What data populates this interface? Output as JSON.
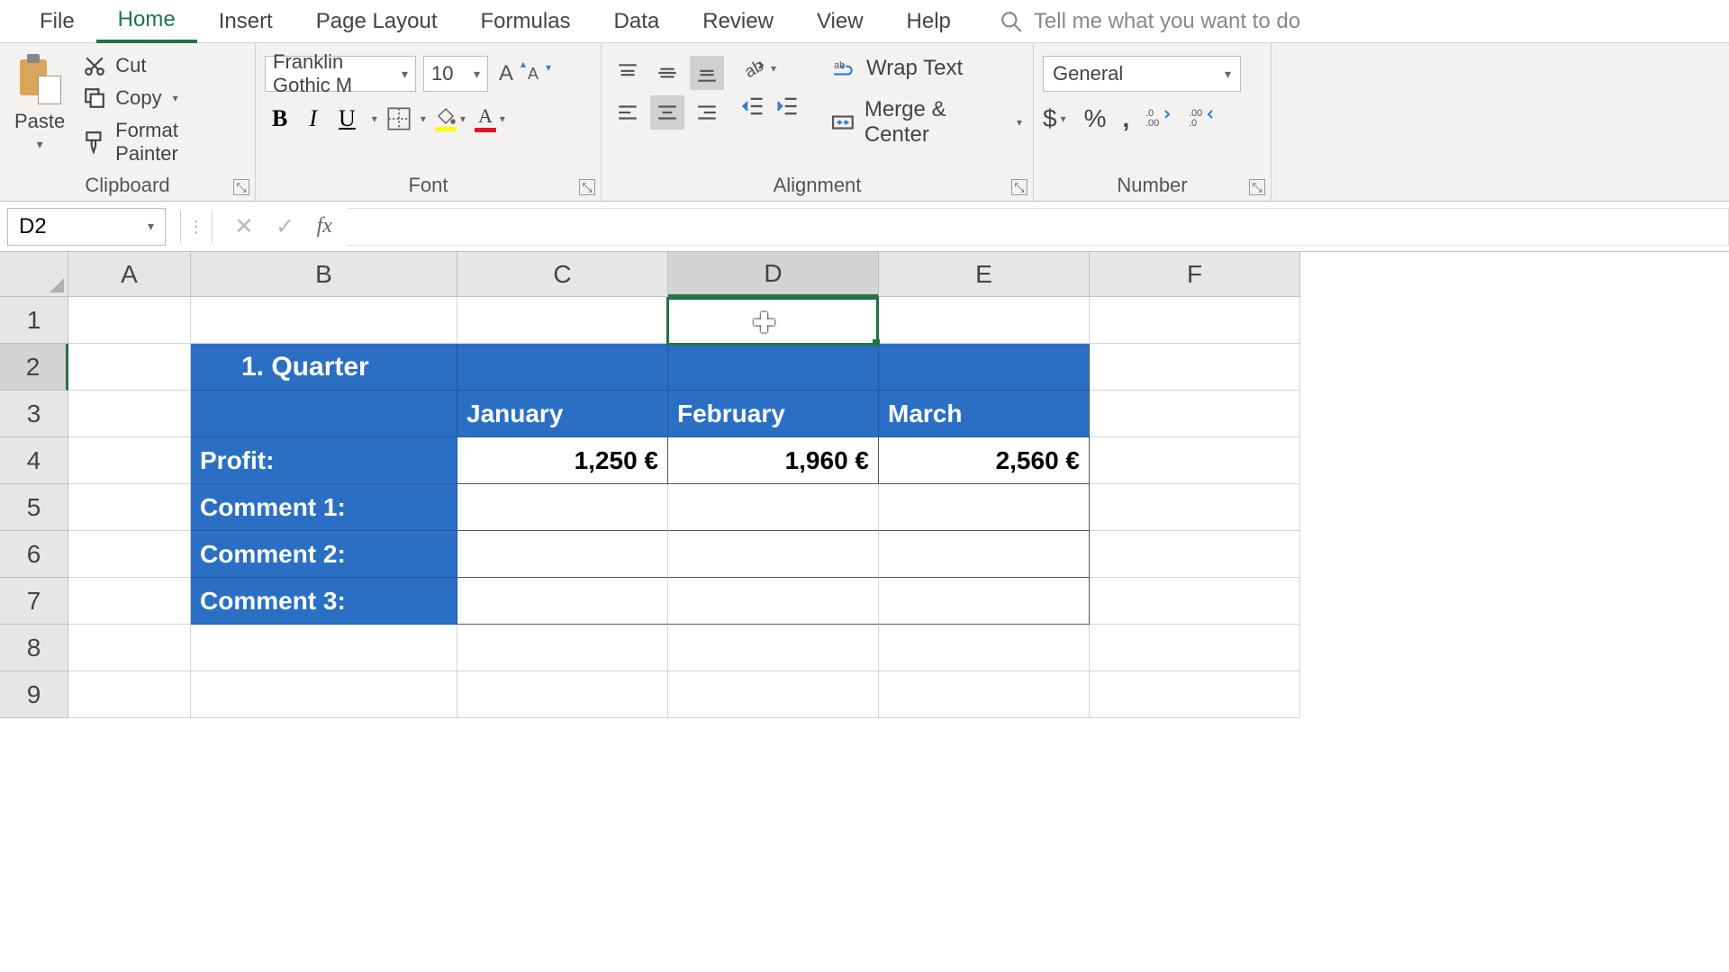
{
  "tabs": {
    "file": "File",
    "home": "Home",
    "insert": "Insert",
    "page_layout": "Page Layout",
    "formulas": "Formulas",
    "data": "Data",
    "review": "Review",
    "view": "View",
    "help": "Help",
    "tell_me": "Tell me what you want to do"
  },
  "ribbon": {
    "clipboard": {
      "label": "Clipboard",
      "paste": "Paste",
      "cut": "Cut",
      "copy": "Copy",
      "format_painter": "Format Painter"
    },
    "font": {
      "label": "Font",
      "name": "Franklin Gothic M",
      "size": "10"
    },
    "alignment": {
      "label": "Alignment",
      "wrap": "Wrap Text",
      "merge": "Merge & Center"
    },
    "number": {
      "label": "Number",
      "format": "General"
    }
  },
  "formula_bar": {
    "name_box": "D2",
    "formula": ""
  },
  "columns": {
    "A": "A",
    "B": "B",
    "C": "C",
    "D": "D",
    "E": "E",
    "F": "F"
  },
  "rows": [
    "1",
    "2",
    "3",
    "4",
    "5",
    "6",
    "7",
    "8",
    "9"
  ],
  "sheet": {
    "b2": "1. Quarter",
    "c3": "January",
    "d3": "February",
    "e3": "March",
    "b4": "Profit:",
    "c4": "1,250 €",
    "d4": "1,960 €",
    "e4": "2,560 €",
    "b5": "Comment 1:",
    "b6": "Comment 2:",
    "b7": "Comment 3:"
  }
}
